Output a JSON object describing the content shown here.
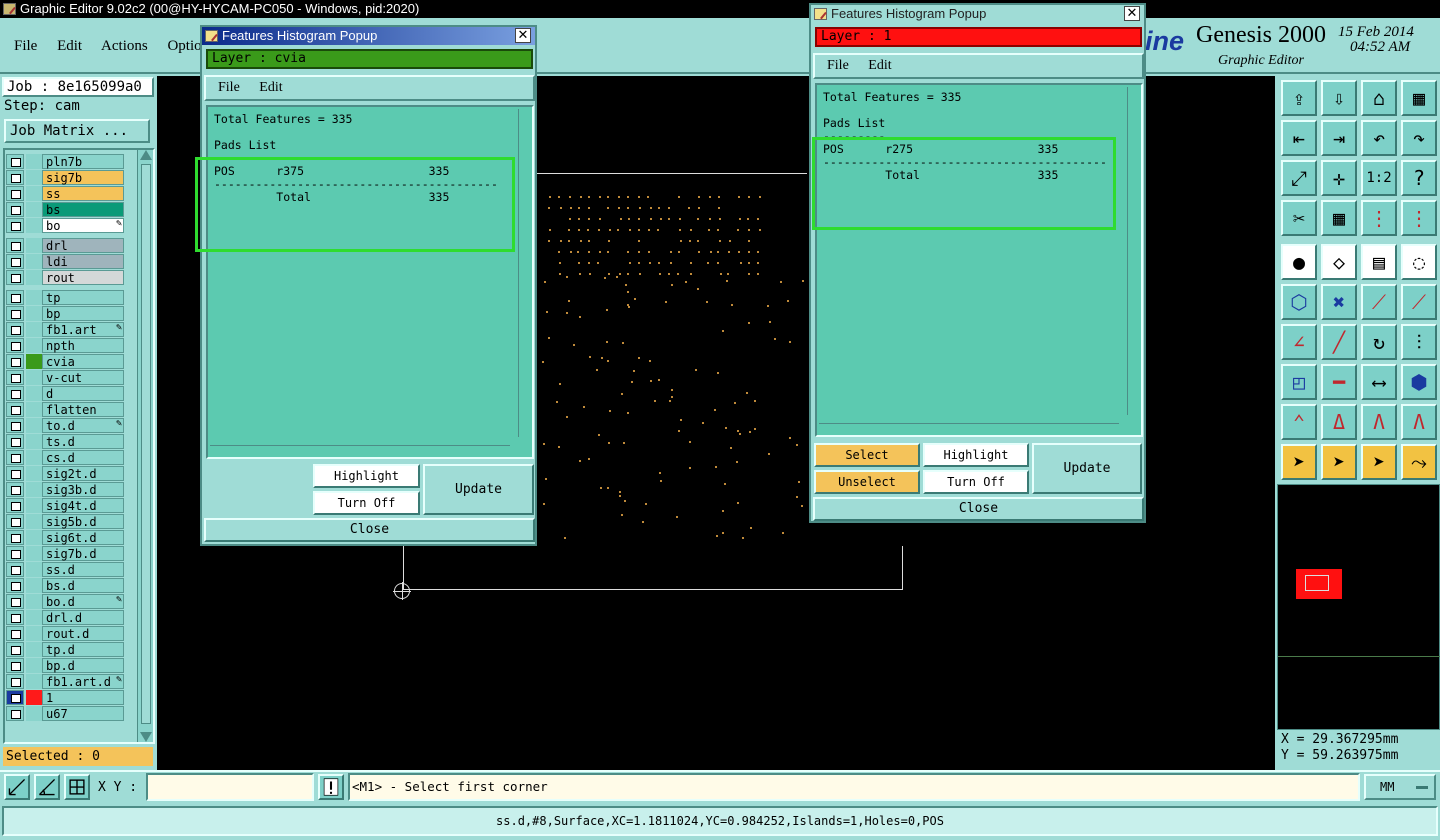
{
  "window": {
    "title": "Graphic Editor 9.02c2 (00@HY-HYCAM-PC050 - Windows, pid:2020)"
  },
  "menu": [
    "File",
    "Edit",
    "Actions",
    "Optio"
  ],
  "brand": {
    "logo_fragment": "ine",
    "product": "Genesis 2000",
    "subtitle": "Graphic Editor",
    "date": "15 Feb 2014",
    "time": "04:52 AM"
  },
  "job": {
    "job_label": "Job : 8e165099a0",
    "step_label": "Step: cam",
    "matrix_button": "Job Matrix ..."
  },
  "layers": [
    {
      "name": "pln7b",
      "color": "#8ad4cc",
      "bg": "#8ad4cc"
    },
    {
      "name": "sig7b",
      "color": "#8ad4cc",
      "bg": "#f4c35a"
    },
    {
      "name": "ss",
      "color": "#8ad4cc",
      "bg": "#f4c35a"
    },
    {
      "name": "bs",
      "color": "#8ad4cc",
      "bg": "#0a9a78"
    },
    {
      "name": "bo",
      "color": "#8ad4cc",
      "bg": "#ffffff",
      "mark": true
    },
    {
      "name": "drl",
      "color": "#8ad4cc",
      "bg": "#9fb4bc"
    },
    {
      "name": "ldi",
      "color": "#8ad4cc",
      "bg": "#9fb4bc"
    },
    {
      "name": "rout",
      "color": "#8ad4cc",
      "bg": "#d4d8d8"
    },
    {
      "name": "tp",
      "color": "#8ad4cc",
      "bg": "#8ad4cc"
    },
    {
      "name": "bp",
      "color": "#8ad4cc",
      "bg": "#8ad4cc"
    },
    {
      "name": "fb1.art",
      "color": "#8ad4cc",
      "bg": "#8ad4cc",
      "mark": true
    },
    {
      "name": "npth",
      "color": "#8ad4cc",
      "bg": "#8ad4cc"
    },
    {
      "name": "cvia",
      "color": "#3a9a1a",
      "bg": "#8ad4cc"
    },
    {
      "name": "v-cut",
      "color": "#8ad4cc",
      "bg": "#8ad4cc"
    },
    {
      "name": "d",
      "color": "#8ad4cc",
      "bg": "#8ad4cc"
    },
    {
      "name": "flatten",
      "color": "#8ad4cc",
      "bg": "#8ad4cc"
    },
    {
      "name": "to.d",
      "color": "#8ad4cc",
      "bg": "#8ad4cc",
      "mark": true
    },
    {
      "name": "ts.d",
      "color": "#8ad4cc",
      "bg": "#8ad4cc"
    },
    {
      "name": "cs.d",
      "color": "#8ad4cc",
      "bg": "#8ad4cc"
    },
    {
      "name": "sig2t.d",
      "color": "#8ad4cc",
      "bg": "#8ad4cc"
    },
    {
      "name": "sig3b.d",
      "color": "#8ad4cc",
      "bg": "#8ad4cc"
    },
    {
      "name": "sig4t.d",
      "color": "#8ad4cc",
      "bg": "#8ad4cc"
    },
    {
      "name": "sig5b.d",
      "color": "#8ad4cc",
      "bg": "#8ad4cc"
    },
    {
      "name": "sig6t.d",
      "color": "#8ad4cc",
      "bg": "#8ad4cc"
    },
    {
      "name": "sig7b.d",
      "color": "#8ad4cc",
      "bg": "#8ad4cc"
    },
    {
      "name": "ss.d",
      "color": "#8ad4cc",
      "bg": "#8ad4cc"
    },
    {
      "name": "bs.d",
      "color": "#8ad4cc",
      "bg": "#8ad4cc"
    },
    {
      "name": "bo.d",
      "color": "#8ad4cc",
      "bg": "#8ad4cc",
      "mark": true
    },
    {
      "name": "drl.d",
      "color": "#8ad4cc",
      "bg": "#8ad4cc"
    },
    {
      "name": "rout.d",
      "color": "#8ad4cc",
      "bg": "#8ad4cc"
    },
    {
      "name": "tp.d",
      "color": "#8ad4cc",
      "bg": "#8ad4cc"
    },
    {
      "name": "bp.d",
      "color": "#8ad4cc",
      "bg": "#8ad4cc"
    },
    {
      "name": "fb1.art.d",
      "color": "#8ad4cc",
      "bg": "#8ad4cc",
      "mark": true
    },
    {
      "name": "1",
      "color": "#ff1a1a",
      "bg": "#8ad4cc",
      "selected": true
    },
    {
      "name": "u67",
      "color": "#8ad4cc",
      "bg": "#8ad4cc"
    }
  ],
  "selected_label": "Selected : 0",
  "popup1": {
    "title": "Features Histogram Popup",
    "layer": "Layer :  cvia",
    "menu_file": "File",
    "menu_edit": "Edit",
    "lines": [
      "Total Features = 335",
      "",
      "Pads List",
      "---------",
      "POS      r375                  335",
      "-----------------------------------------",
      "         Total                 335"
    ],
    "highlight": "Highlight",
    "turnoff": "Turn Off",
    "update": "Update",
    "close": "Close"
  },
  "popup2": {
    "title": "Features Histogram Popup",
    "layer": "Layer :  1",
    "menu_file": "File",
    "menu_edit": "Edit",
    "lines": [
      "Total Features = 335",
      "",
      "Pads List",
      "---------",
      "POS      r275                  335",
      "-----------------------------------------",
      "         Total                 335"
    ],
    "select": "Select",
    "unselect": "Unselect",
    "highlight": "Highlight",
    "turnoff": "Turn Off",
    "update": "Update",
    "close": "Close"
  },
  "coords": {
    "x": "X = 29.367295mm",
    "y": "Y = 59.263975mm"
  },
  "bottom": {
    "xy_label": "X Y :",
    "prompt": "<M1> - Select first corner",
    "units": "MM",
    "status": "ss.d,#8,Surface,XC=1.1811024,YC=0.984252,Islands=1,Holes=0,POS"
  },
  "toolbar_buttons": [
    "open-job-icon",
    "save-icon",
    "home-icon",
    "window-icon",
    "zoom-out-left-icon",
    "zoom-in-right-icon",
    "undo-zoom-icon",
    "redo-zoom-icon",
    "fit-screen-icon",
    "zoom-center-icon",
    "ratio-icon",
    "help-icon",
    "measure-icon",
    "grid-icon",
    "layer-pads-icon",
    "layer-pads-alt-icon",
    "pad-filled-icon",
    "rotate-icon",
    "ruler-icon",
    "circle-dotted-icon",
    "connect-nodes-icon",
    "snap-cross-icon",
    "line-point-icon",
    "line-point-alt-icon",
    "angle-icon",
    "slash-icon",
    "arc-icon",
    "split-icon",
    "node-square-icon",
    "dash-icon",
    "dim-icon",
    "shapes-icon",
    "trace-icon",
    "triangle-a-icon",
    "arch-icon",
    "arch-cross-icon",
    "pointer-icon",
    "pointer-box-icon",
    "pointer-red-icon",
    "route-icon"
  ]
}
